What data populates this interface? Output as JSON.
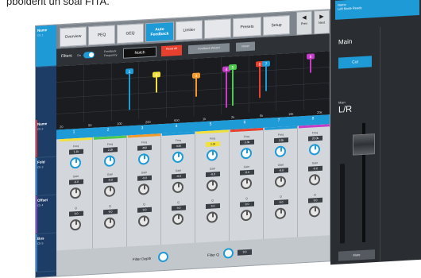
{
  "caption": "pbolderit un soal FITA.",
  "sidebar": {
    "items": [
      {
        "label": "Name",
        "sub": "Ch 1",
        "color": "#1e9ad6"
      },
      {
        "label": "Name",
        "sub": "Ch 2",
        "color": "#d23a4a"
      },
      {
        "label": "Fold",
        "sub": "Ch 3",
        "color": "#2e7fd0"
      },
      {
        "label": "Offset",
        "sub": "Ch 4",
        "color": "#7a4bc6"
      },
      {
        "label": "Bus",
        "sub": "Ch 5",
        "color": "#2e7fd0"
      }
    ]
  },
  "tabs": [
    {
      "label": "Overview",
      "active": false
    },
    {
      "label": "PEQ",
      "active": false
    },
    {
      "label": "GEQ",
      "active": false
    },
    {
      "label": "Auto Feedback",
      "active": true
    },
    {
      "label": "Limiter",
      "active": false
    },
    {
      "label": "",
      "active": false
    },
    {
      "label": "Presets",
      "active": false
    },
    {
      "label": "Setup",
      "active": false
    }
  ],
  "nav": {
    "prev": "Prev",
    "next": "Next"
  },
  "controls": {
    "filters_label": "Filters",
    "toggle_label": "On",
    "feedback_label": "Feedback Frequency",
    "feedback_value": "Notch",
    "reset_label": "Reset All",
    "wizard_label": "Feedback Wizard",
    "reset2_label": "Reset"
  },
  "graph": {
    "markers": [
      {
        "num": "1",
        "color": "#1e9ad6"
      },
      {
        "num": "2",
        "color": "#f2e03c"
      },
      {
        "num": "3",
        "color": "#f29a2c"
      },
      {
        "num": "4",
        "color": "#c53cc7"
      },
      {
        "num": "5",
        "color": "#4ecb4e"
      },
      {
        "num": "6",
        "color": "#e8402f"
      },
      {
        "num": "7",
        "color": "#1e9ad6"
      },
      {
        "num": "8",
        "color": "#c53cc7"
      }
    ],
    "x_ticks": [
      "20",
      "50",
      "100",
      "200",
      "500",
      "1k",
      "2k",
      "5k",
      "10k",
      "20k"
    ]
  },
  "bands": [
    "1",
    "2",
    "3",
    "4",
    "5",
    "6",
    "7",
    "8"
  ],
  "filters": [
    {
      "stripe": "#f2e03c",
      "freq": "Freq",
      "freq_val": "1.1k",
      "gain": "Gain",
      "gain_val": "-9.0",
      "q": "Q",
      "q_val": "9.0",
      "hl": false
    },
    {
      "stripe": "#4ecb4e",
      "freq": "Freq",
      "freq_val": "2.2k",
      "gain": "Gain",
      "gain_val": "-9.0",
      "q": "Q",
      "q_val": "9.0",
      "hl": false
    },
    {
      "stripe": "#f29a2c",
      "freq": "Freq",
      "freq_val": "450",
      "gain": "Gain",
      "gain_val": "-9.0",
      "q": "Q",
      "q_val": "9.0",
      "hl": false
    },
    {
      "stripe": "#1e9ad6",
      "freq": "Freq",
      "freq_val": "630",
      "gain": "Gain",
      "gain_val": "-9.0",
      "q": "Q",
      "q_val": "9.0",
      "hl": false
    },
    {
      "stripe": "#f2e03c",
      "freq": "Freq",
      "freq_val": "3.3k",
      "gain": "Gain",
      "gain_val": "-9.0",
      "q": "Q",
      "q_val": "9.0",
      "hl": true
    },
    {
      "stripe": "#e8402f",
      "freq": "Freq",
      "freq_val": "2.3k",
      "gain": "Gain",
      "gain_val": "-9.0",
      "q": "Q",
      "q_val": "9.0",
      "hl": false
    },
    {
      "stripe": "#1e9ad6",
      "freq": "Freq",
      "freq_val": "2.5k",
      "gain": "Gain",
      "gain_val": "-9.0",
      "q": "Q",
      "q_val": "9.0",
      "hl": false
    },
    {
      "stripe": "#c53cc7",
      "freq": "Freq",
      "freq_val": "20.0k",
      "gain": "Gain",
      "gain_val": "-9.0",
      "q": "Q",
      "q_val": "9.0",
      "hl": false
    }
  ],
  "bottom": {
    "depth_label": "Filter Depth",
    "q_label": "Filter Q",
    "q_val": "9.0"
  },
  "right_panel": {
    "name_top": "Name",
    "name_sub": "Left Mode Ready",
    "title": "Main",
    "cut_label": "Cut",
    "small_label": "Main",
    "lr_label": "L/R",
    "mute_label": "Mute"
  }
}
